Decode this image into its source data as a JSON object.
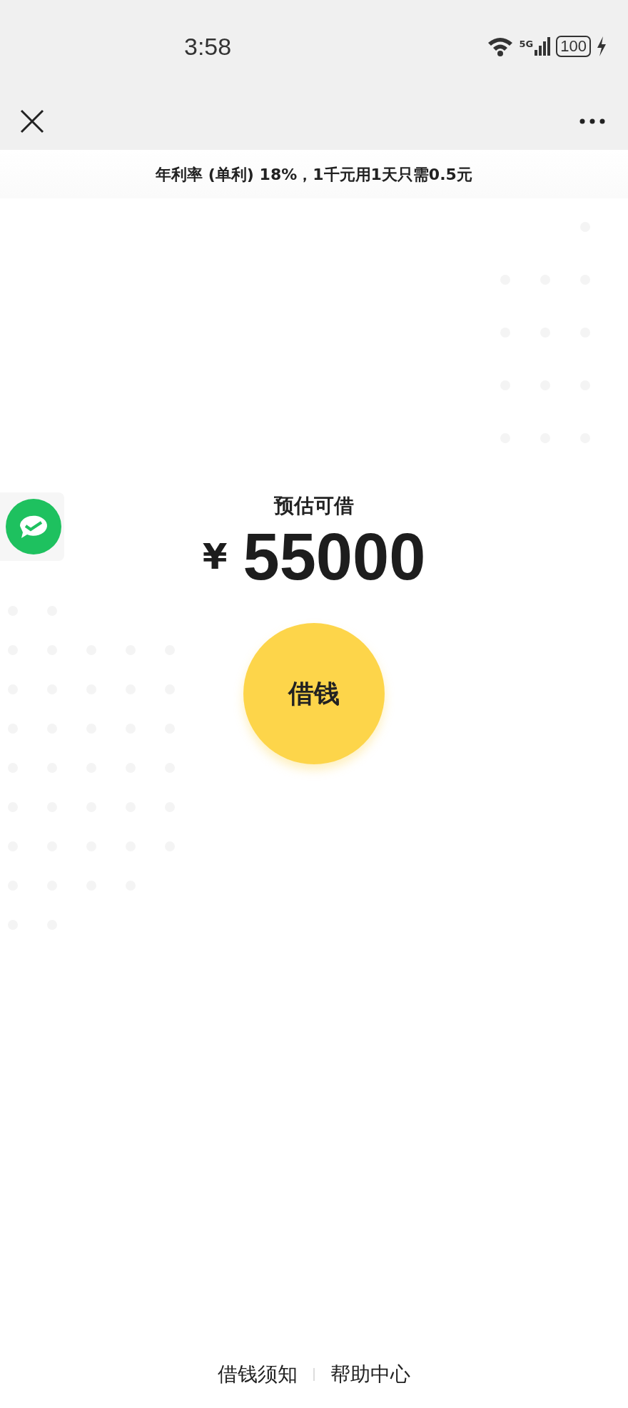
{
  "status_bar": {
    "time": "3:58",
    "network": "5G",
    "battery": "100",
    "charging": true
  },
  "banner": {
    "text": "年利率 (单利) 18%，1千元用1天只需0.5元"
  },
  "quota": {
    "label": "预估可借",
    "currency": "¥",
    "amount": "55000"
  },
  "borrow_button": {
    "label": "借钱"
  },
  "footer_links": [
    {
      "label": "借钱须知"
    },
    {
      "label": "帮助中心"
    }
  ]
}
